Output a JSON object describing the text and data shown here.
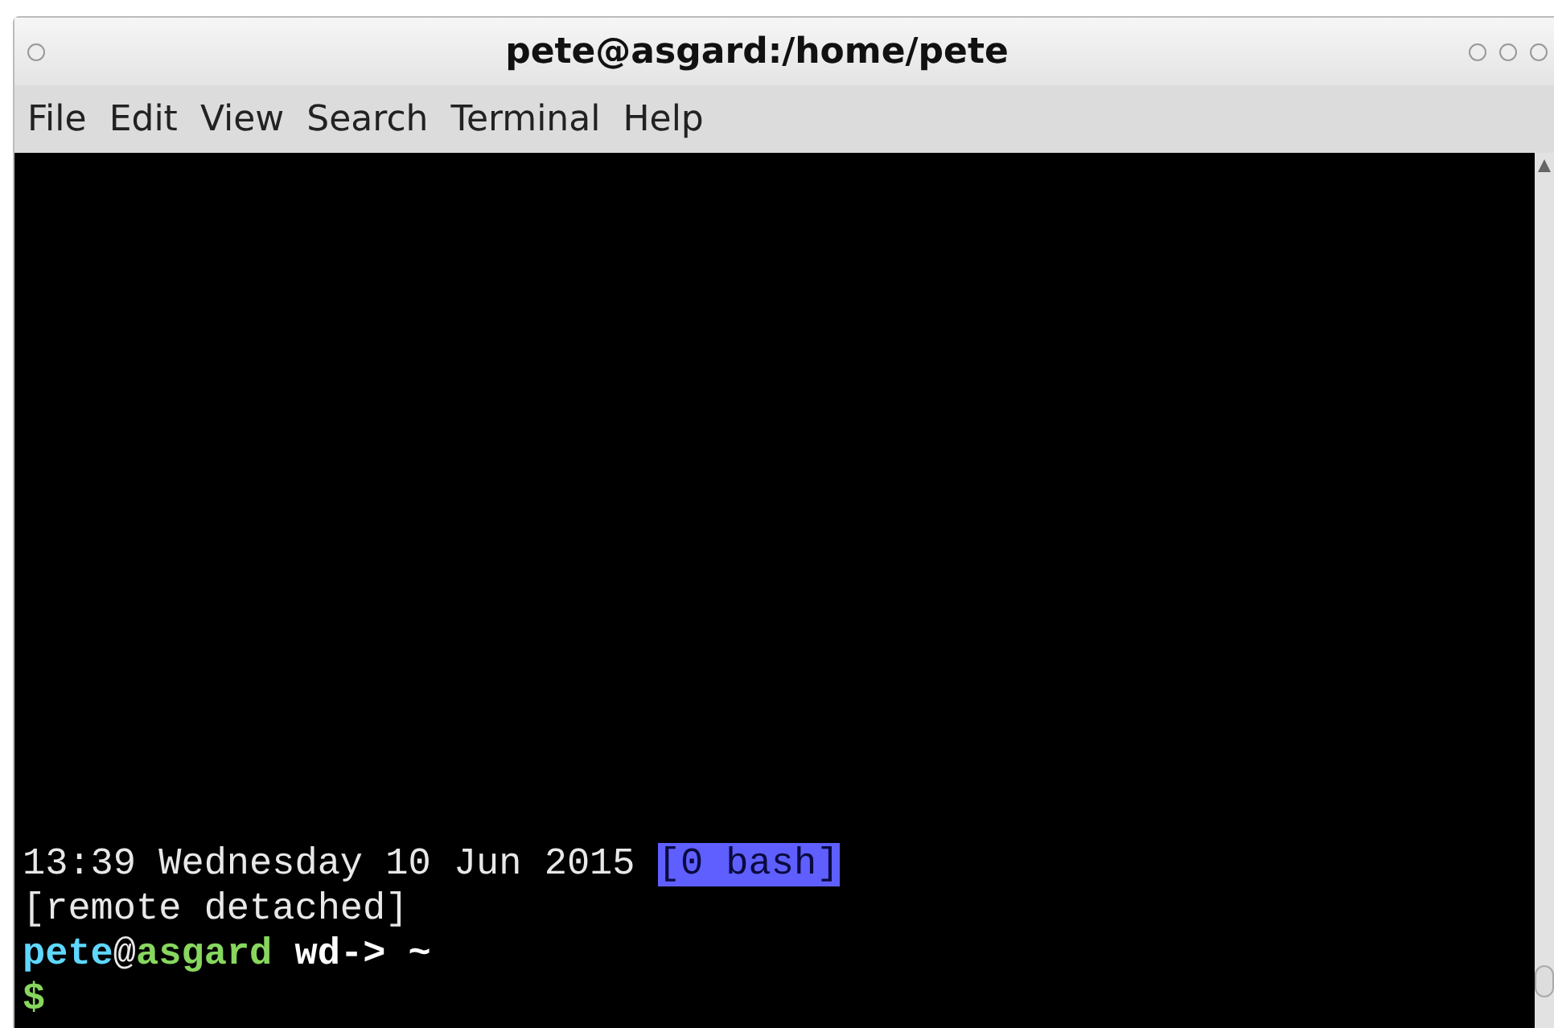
{
  "window": {
    "title": "pete@asgard:/home/pete"
  },
  "menu": [
    "File",
    "Edit",
    "View",
    "Search",
    "Terminal",
    "Help"
  ],
  "terminal": {
    "lines": [
      {
        "segments": [
          {
            "text": "13:39 Wednesday 10 Jun 2015 ",
            "kind": "plain"
          },
          {
            "text": "[0 bash]",
            "kind": "highlight"
          }
        ]
      },
      {
        "segments": [
          {
            "text": "[remote detached]",
            "kind": "plain"
          }
        ]
      },
      {
        "segments": [
          {
            "text": "pete",
            "kind": "user"
          },
          {
            "text": "@",
            "kind": "plain"
          },
          {
            "text": "asgard",
            "kind": "host"
          },
          {
            "text": " wd-> ~",
            "kind": "bold"
          }
        ]
      },
      {
        "segments": [
          {
            "text": "$",
            "kind": "host"
          }
        ]
      }
    ]
  }
}
